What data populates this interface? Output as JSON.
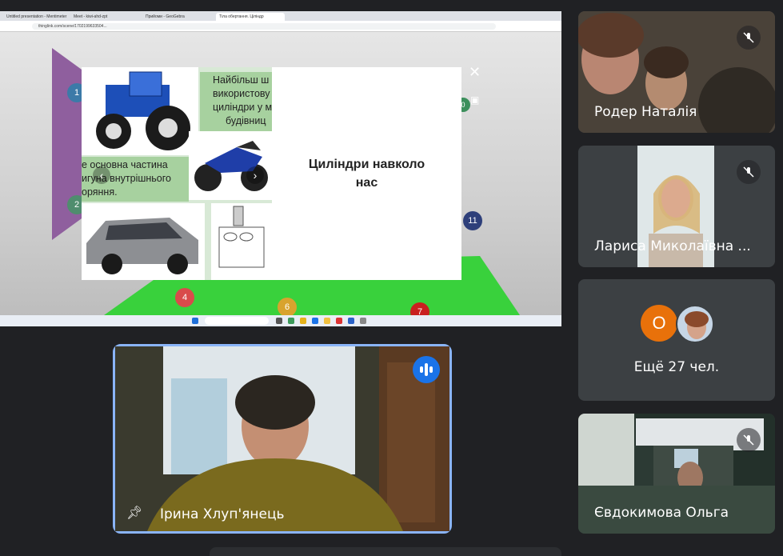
{
  "browser": {
    "tabs": [
      "Untitled presentation - Mentimeter",
      "Meet - kiwi-ahd-zpt",
      "Прийоми - GeoGebra",
      "Тіла обертання. Ціліндр"
    ],
    "url": "thinglink.com/scene/1702199633504..."
  },
  "slide": {
    "text_top": [
      "Найбільш ш",
      "використову",
      "циліндри у м",
      "будівниц"
    ],
    "text_left": [
      "е основна частина",
      "игуна внутрішнього",
      "оряння."
    ],
    "title": "Циліндри навколо нас"
  },
  "scene_markers": [
    "1",
    "2",
    "4",
    "6",
    "7",
    "11",
    "0"
  ],
  "participants": [
    {
      "name": "Родер Наталія",
      "muted": true
    },
    {
      "name": "Лариса Миколаївна ...",
      "muted": true
    },
    {
      "name": "Євдокимова Ольга",
      "muted": true
    }
  ],
  "more": {
    "avatar_letter": "О",
    "label": "Ещё 27 чел."
  },
  "speaker": {
    "name": "Ірина Хлуп'янець",
    "pinned": true,
    "speaking": true
  },
  "colors": {
    "bg": "#202124",
    "tile": "#3c4043",
    "accent": "#8ab4f8",
    "avatar_orange": "#e8710a",
    "speaking": "#1a73e8"
  }
}
